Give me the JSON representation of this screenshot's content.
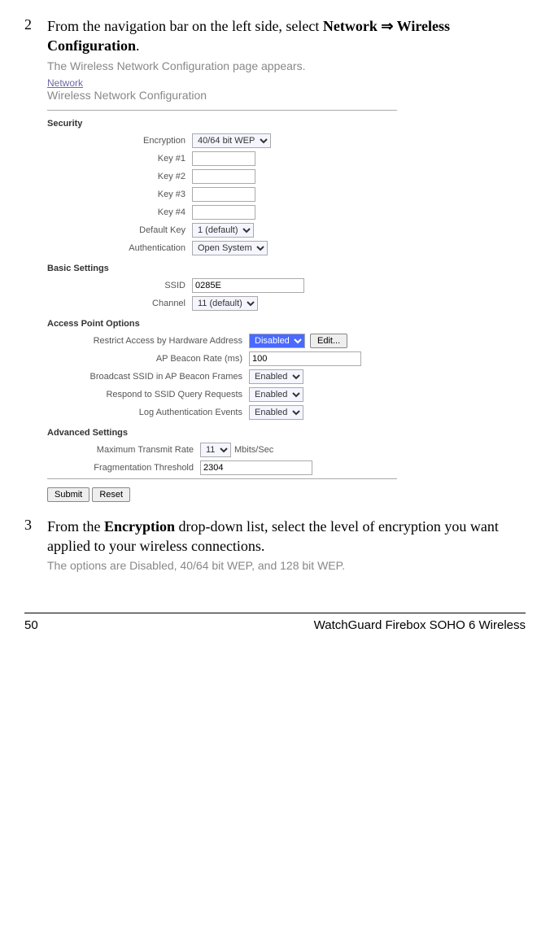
{
  "step2": {
    "num": "2",
    "text_before_link": "From the navigation bar on the left side, select ",
    "link_text": "Network ⇒ Wireless Configuration",
    "text_after_link": ".",
    "caption": "The Wireless Network Configuration page appears."
  },
  "screenshot": {
    "breadcrumb": "Network",
    "title": "Wireless Network Configuration",
    "sections": {
      "security": {
        "heading": "Security",
        "encryption_label": "Encryption",
        "encryption_value": "40/64 bit WEP",
        "key1_label": "Key #1",
        "key1_value": "",
        "key2_label": "Key #2",
        "key2_value": "",
        "key3_label": "Key #3",
        "key3_value": "",
        "key4_label": "Key #4",
        "key4_value": "",
        "defaultkey_label": "Default Key",
        "defaultkey_value": "1 (default)",
        "auth_label": "Authentication",
        "auth_value": "Open System"
      },
      "basic": {
        "heading": "Basic Settings",
        "ssid_label": "SSID",
        "ssid_value": "0285E",
        "channel_label": "Channel",
        "channel_value": "11 (default)"
      },
      "ap": {
        "heading": "Access Point Options",
        "restrict_label": "Restrict Access by Hardware Address",
        "restrict_value": "Disabled",
        "edit_button": "Edit...",
        "beacon_label": "AP Beacon Rate (ms)",
        "beacon_value": "100",
        "broadcast_label": "Broadcast SSID in AP Beacon Frames",
        "broadcast_value": "Enabled",
        "respond_label": "Respond to SSID Query Requests",
        "respond_value": "Enabled",
        "log_label": "Log Authentication Events",
        "log_value": "Enabled"
      },
      "advanced": {
        "heading": "Advanced Settings",
        "maxrate_label": "Maximum Transmit Rate",
        "maxrate_value": "11",
        "maxrate_unit": "Mbits/Sec",
        "frag_label": "Fragmentation Threshold",
        "frag_value": "2304"
      }
    },
    "submit_button": "Submit",
    "reset_button": "Reset"
  },
  "step3": {
    "num": "3",
    "text_before_bold": "From the ",
    "bold_text": "Encryption",
    "text_after_bold": " drop-down list, select the level of encryption you want applied to your wireless connections.",
    "caption": "The options are Disabled, 40/64 bit WEP, and 128 bit WEP."
  },
  "footer": {
    "page": "50",
    "title": "WatchGuard Firebox SOHO 6 Wireless"
  }
}
